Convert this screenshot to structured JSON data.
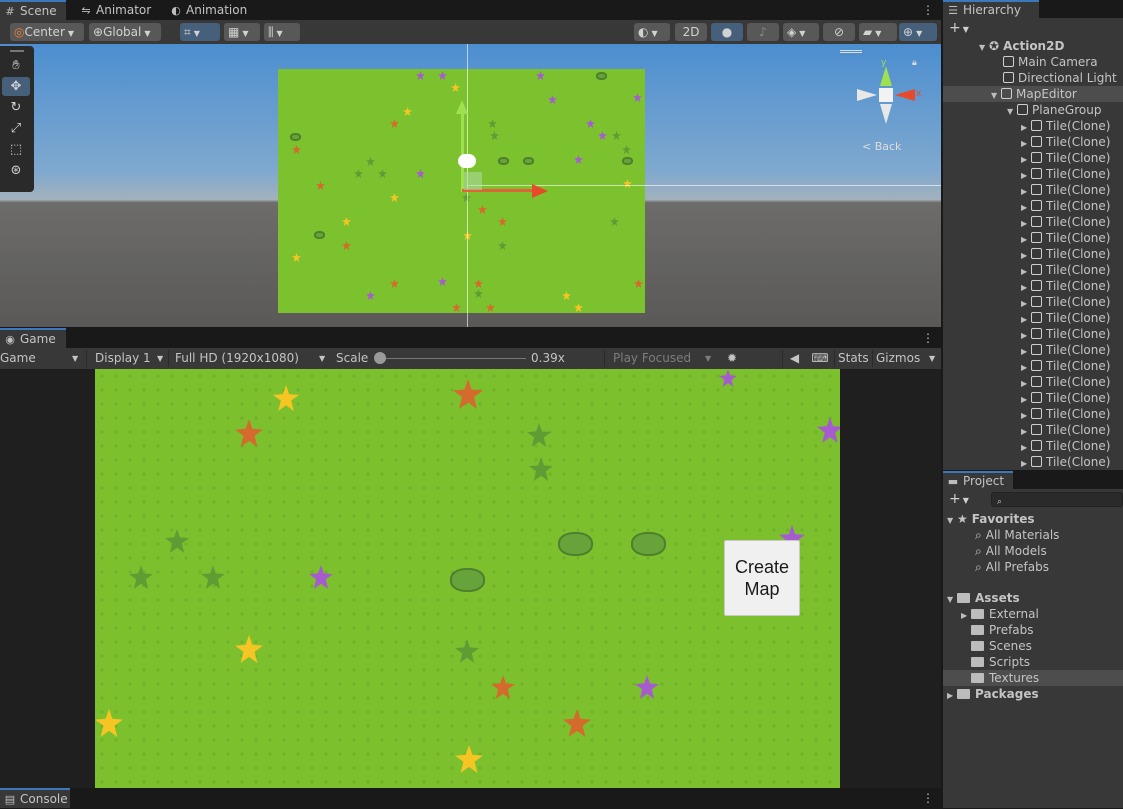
{
  "scene_tabs": [
    {
      "icon": "#",
      "label": "Scene"
    },
    {
      "icon": "⇋",
      "label": "Animator"
    },
    {
      "icon": "◐",
      "label": "Animation"
    }
  ],
  "scene_toolbar": {
    "pivot": "Center",
    "space": "Global",
    "two_d": "2D"
  },
  "scene_gizmo": {
    "label": "Back",
    "x": "x",
    "y": "y"
  },
  "game_tab": {
    "label": "Game"
  },
  "game_toolbar": {
    "view": "Game",
    "display": "Display 1",
    "resolution": "Full HD (1920x1080)",
    "scale_label": "Scale",
    "scale_value": "0.39x",
    "play_mode": "Play Focused",
    "stats": "Stats",
    "gizmos": "Gizmos"
  },
  "create_map_button": {
    "label": "Create Map",
    "line1": "Create",
    "line2": "Map"
  },
  "console_tab": {
    "label": "Console"
  },
  "hierarchy": {
    "title": "Hierarchy",
    "add": "+",
    "root": "Action2D",
    "items": [
      {
        "label": "Main Camera"
      },
      {
        "label": "Directional Light"
      },
      {
        "label": "MapEditor"
      },
      {
        "label": "PlaneGroup"
      }
    ],
    "tiles": [
      "Tile(Clone)",
      "Tile(Clone)",
      "Tile(Clone)",
      "Tile(Clone)",
      "Tile(Clone)",
      "Tile(Clone)",
      "Tile(Clone)",
      "Tile(Clone)",
      "Tile(Clone)",
      "Tile(Clone)",
      "Tile(Clone)",
      "Tile(Clone)",
      "Tile(Clone)",
      "Tile(Clone)",
      "Tile(Clone)",
      "Tile(Clone)",
      "Tile(Clone)",
      "Tile(Clone)",
      "Tile(Clone)",
      "Tile(Clone)",
      "Tile(Clone)",
      "Tile(Clone)"
    ]
  },
  "project": {
    "title": "Project",
    "add": "+",
    "favorites": "Favorites",
    "fav_items": [
      "All Materials",
      "All Models",
      "All Prefabs"
    ],
    "assets": "Assets",
    "asset_items": [
      "External",
      "Prefabs",
      "Scenes",
      "Scripts",
      "Textures"
    ],
    "packages": "Packages"
  },
  "colors": {
    "grass": "#7cc22e",
    "selection": "#46607c",
    "accent_tab": "#3a79bb"
  }
}
